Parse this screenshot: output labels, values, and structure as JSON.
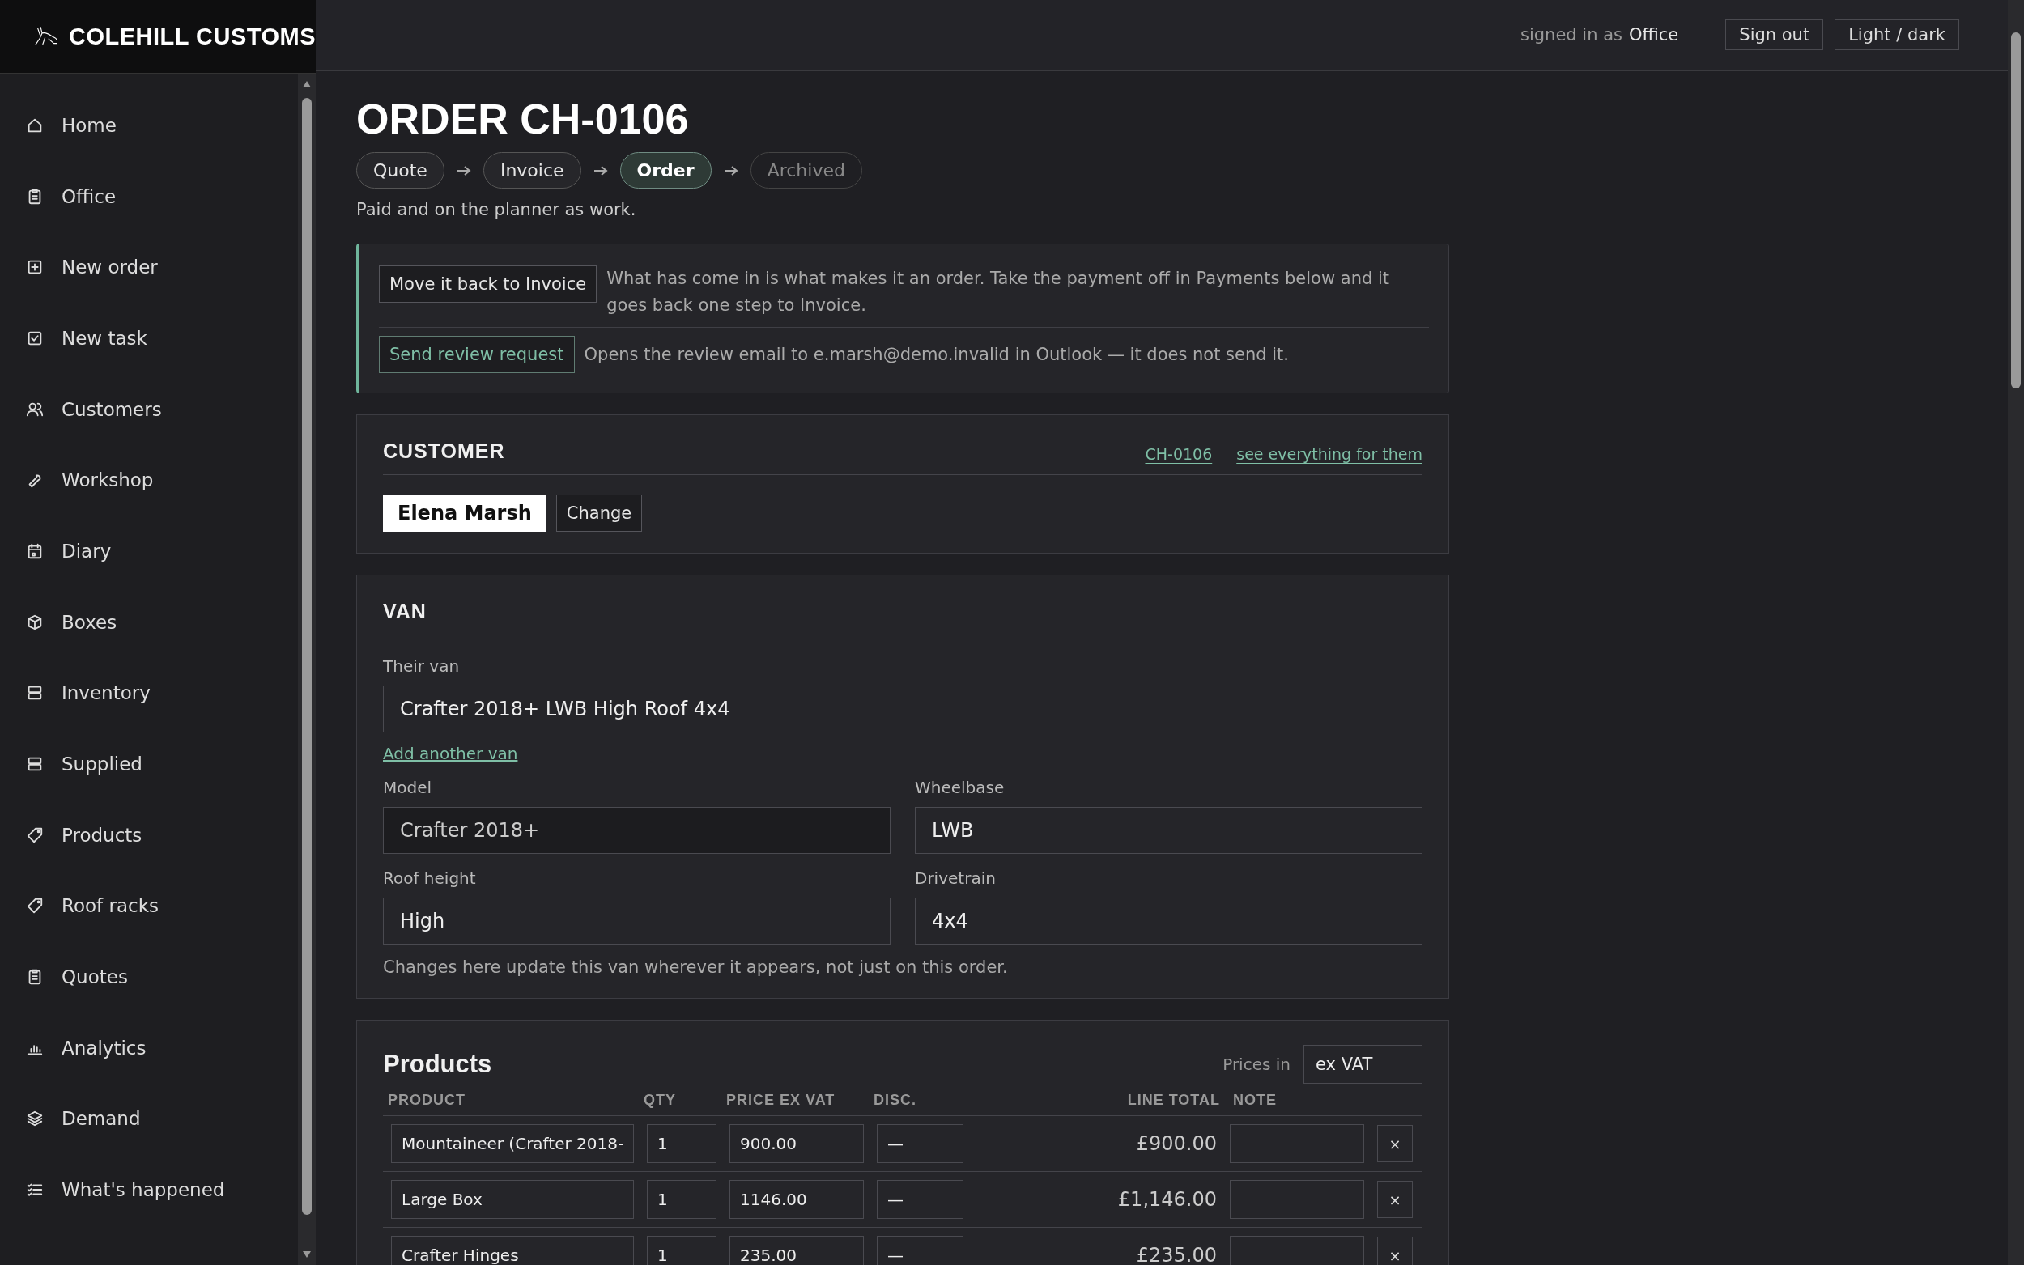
{
  "brand": {
    "name": "COLEHILL CUSTOMS"
  },
  "nav": [
    {
      "label": "Home",
      "selected": false
    },
    {
      "label": "Office",
      "selected": false
    },
    {
      "label": "New order",
      "selected": false
    },
    {
      "label": "New task",
      "selected": false
    },
    {
      "label": "Customers",
      "selected": false
    },
    {
      "label": "Workshop",
      "selected": false
    },
    {
      "label": "Diary",
      "selected": false
    },
    {
      "label": "Boxes",
      "selected": false
    },
    {
      "label": "Inventory",
      "selected": false
    },
    {
      "label": "Supplied",
      "selected": false
    },
    {
      "label": "Products",
      "selected": false
    },
    {
      "label": "Roof racks",
      "selected": false
    },
    {
      "label": "Quotes",
      "selected": false
    },
    {
      "label": "Analytics",
      "selected": false
    },
    {
      "label": "Demand",
      "selected": false
    },
    {
      "label": "What's happened",
      "selected": false
    }
  ],
  "topbar": {
    "signed_in_label": "signed in as",
    "user": "Office",
    "buttons": [
      "Sign out",
      "Light / dark"
    ]
  },
  "page": {
    "title": "ORDER CH-0106",
    "stages": [
      {
        "label": "Quote",
        "selected": false,
        "reached": true
      },
      {
        "label": "Invoice",
        "selected": false,
        "reached": true
      },
      {
        "label": "Order",
        "selected": true,
        "reached": true
      },
      {
        "label": "Archived",
        "selected": false,
        "reached": false
      }
    ],
    "status_note": "Paid and on the planner as work."
  },
  "actions": [
    {
      "kind": "neutral",
      "button": "Move it back to Invoice",
      "text": "What has come in is what makes it an order. Take the payment off in Payments below and it goes back one step to Invoice."
    },
    {
      "kind": "accent",
      "button": "Send review request",
      "text": "Opens the review email to e.marsh@demo.invalid in Outlook — it does not send it."
    }
  ],
  "customer": {
    "heading": "CUSTOMER",
    "links": [
      "CH-0106",
      "see everything for them"
    ],
    "name": "Elena Marsh",
    "change_button": "Change"
  },
  "van": {
    "heading": "VAN",
    "their_van": {
      "label": "Their van",
      "value": "Crafter 2018+ LWB High Roof 4x4"
    },
    "add_link": "Add another van",
    "fields": [
      {
        "label": "Model",
        "value": "Crafter 2018+",
        "readonly": true
      },
      {
        "label": "Wheelbase",
        "value": "LWB",
        "readonly": false
      },
      {
        "label": "Roof height",
        "value": "High",
        "readonly": false
      },
      {
        "label": "Drivetrain",
        "value": "4x4",
        "readonly": false
      }
    ],
    "note": "Changes here update this van wherever it appears, not just on this order."
  },
  "products": {
    "heading": "Products",
    "prices_in": {
      "label": "Prices in",
      "value": "ex VAT"
    },
    "columns": [
      "PRODUCT",
      "QTY",
      "PRICE EX VAT",
      "DISC.",
      "LINE TOTAL",
      "NOTE"
    ],
    "rows": [
      {
        "product": "Mountaineer (Crafter 2018-",
        "qty": "1",
        "price": "900.00",
        "discount": "—",
        "line_total": "£900.00",
        "remove": "×"
      },
      {
        "product": "Large Box",
        "qty": "1",
        "price": "1146.00",
        "discount": "—",
        "line_total": "£1,146.00",
        "remove": "×"
      },
      {
        "product": "Crafter Hinges",
        "qty": "1",
        "price": "235.00",
        "discount": "—",
        "line_total": "£235.00",
        "remove": "×"
      }
    ]
  }
}
